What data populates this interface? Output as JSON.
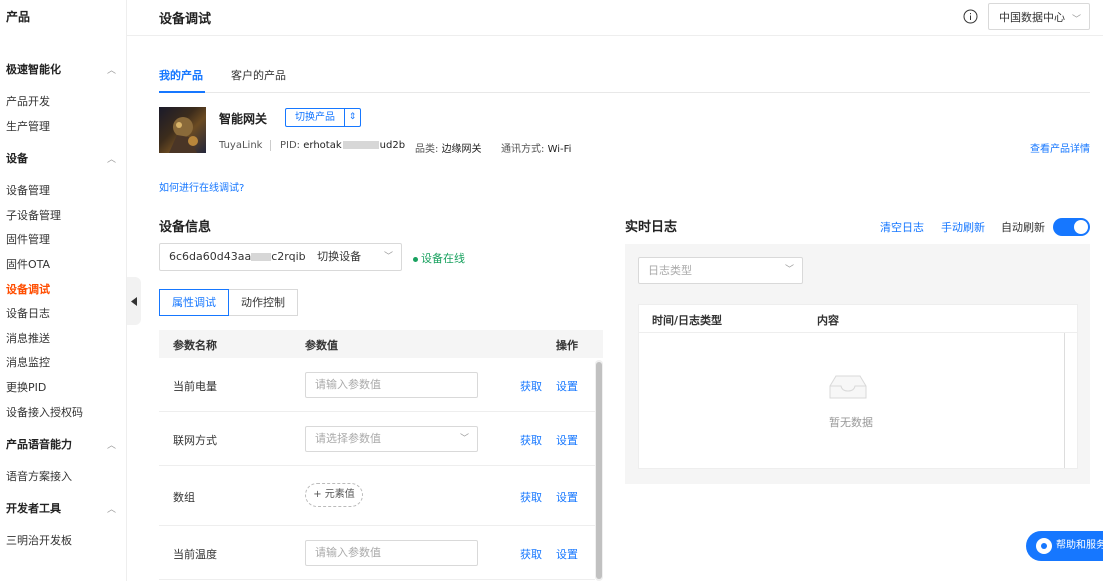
{
  "sidebar": {
    "brand": "产品",
    "groups": [
      {
        "label": "极速智能化",
        "items": [
          "产品开发",
          "生产管理"
        ]
      },
      {
        "label": "设备",
        "items": [
          "设备管理",
          "子设备管理",
          "固件管理",
          "固件OTA",
          "设备调试",
          "设备日志",
          "消息推送",
          "消息监控",
          "更换PID",
          "设备接入授权码"
        ]
      },
      {
        "label": "产品语音能力",
        "items": [
          "语音方案接入"
        ]
      },
      {
        "label": "开发者工具",
        "items": [
          "三明治开发板"
        ]
      }
    ],
    "active_item": "设备调试"
  },
  "header": {
    "title": "设备调试",
    "datacenter": "中国数据中心"
  },
  "tabs": [
    {
      "label": "我的产品",
      "active": true
    },
    {
      "label": "客户的产品",
      "active": false
    }
  ],
  "product": {
    "name": "智能网关",
    "switch_label": "切换产品",
    "platform": "TuyaLink",
    "pid_label": "PID:",
    "pid_prefix": "erhotak",
    "pid_suffix": "ud2b",
    "category_label": "品类:",
    "category": "边缘网关",
    "comm_label": "通讯方式:",
    "comm": "Wi-Fi",
    "detail_link": "查看产品详情"
  },
  "howto_link": "如何进行在线调试?",
  "device_info": {
    "title": "设备信息",
    "device_id_prefix": "6c6da60d43aa",
    "device_id_suffix": "c2rqib",
    "switch_device": "切换设备",
    "status": "设备在线",
    "subtabs": [
      {
        "label": "属性调试",
        "active": true
      },
      {
        "label": "动作控制",
        "active": false
      }
    ],
    "table": {
      "headers": {
        "name": "参数名称",
        "value": "参数值",
        "action": "操作"
      },
      "rows": [
        {
          "name": "当前电量",
          "type": "input",
          "placeholder": "请输入参数值",
          "get": "获取",
          "set": "设置"
        },
        {
          "name": "联网方式",
          "type": "select",
          "placeholder": "请选择参数值",
          "get": "获取",
          "set": "设置"
        },
        {
          "name": "数组",
          "type": "array",
          "placeholder": "+ 元素值",
          "get": "获取",
          "set": "设置"
        },
        {
          "name": "当前温度",
          "type": "input",
          "placeholder": "请输入参数值",
          "get": "获取",
          "set": "设置"
        }
      ]
    }
  },
  "log": {
    "title": "实时日志",
    "clear": "清空日志",
    "manual_refresh": "手动刷新",
    "auto_refresh_label": "自动刷新",
    "auto_refresh_on": true,
    "type_placeholder": "日志类型",
    "col_time": "时间/日志类型",
    "col_content": "内容",
    "empty_text": "暂无数据"
  },
  "help_button": "帮助和服务",
  "colors": {
    "accent": "#1677ff",
    "active_nav": "#ff4d00",
    "online": "#19a15f"
  }
}
